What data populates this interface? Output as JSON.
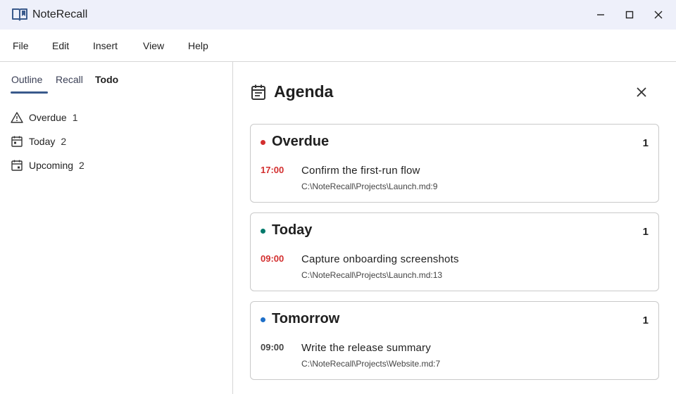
{
  "app": {
    "title": "NoteRecall"
  },
  "menu": [
    "File",
    "Edit",
    "Insert",
    "View",
    "Help"
  ],
  "sidebar": {
    "tabs": [
      {
        "label": "Outline",
        "active": false
      },
      {
        "label": "Recall",
        "active": false
      },
      {
        "label": "Todo",
        "active": true
      }
    ],
    "items": [
      {
        "label": "Overdue",
        "count": "1",
        "icon": "warning-icon"
      },
      {
        "label": "Today",
        "count": "2",
        "icon": "calendar-today-icon"
      },
      {
        "label": "Upcoming",
        "count": "2",
        "icon": "calendar-upcoming-icon"
      }
    ]
  },
  "agenda": {
    "title": "Agenda",
    "icon": "agenda-icon",
    "sections": [
      {
        "title": "Overdue",
        "count": "1",
        "dot_color": "#d32f2f",
        "tasks": [
          {
            "time": "17:00",
            "time_color": "#d32f2f",
            "text": "Confirm the first-run flow",
            "path": "C:\\NoteRecall\\Projects\\Launch.md:9"
          }
        ]
      },
      {
        "title": "Today",
        "count": "1",
        "dot_color": "#00796b",
        "tasks": [
          {
            "time": "09:00",
            "time_color": "#d32f2f",
            "text": "Capture onboarding screenshots",
            "path": "C:\\NoteRecall\\Projects\\Launch.md:13"
          }
        ]
      },
      {
        "title": "Tomorrow",
        "count": "1",
        "dot_color": "#1e6fc8",
        "tasks": [
          {
            "time": "09:00",
            "time_color": "#444444",
            "text": "Write the release summary",
            "path": "C:\\NoteRecall\\Projects\\Website.md:7"
          }
        ]
      }
    ]
  }
}
